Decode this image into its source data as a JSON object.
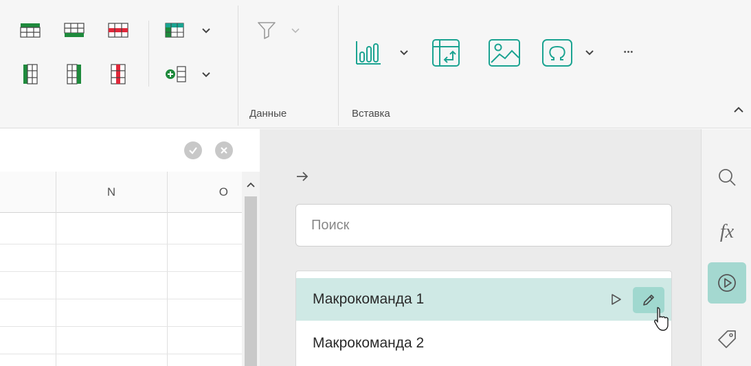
{
  "ribbon": {
    "groups": {
      "data": {
        "label": "Данные"
      },
      "insert": {
        "label": "Вставка"
      }
    },
    "buttons": {
      "insert_rows_above": "insert-rows-above-icon",
      "insert_rows_below": "insert-rows-below-icon",
      "delete_rows": "delete-rows-icon",
      "insert_cols_left": "insert-cols-left-icon",
      "insert_cols_right": "insert-cols-right-icon",
      "delete_cols": "delete-cols-icon",
      "format_table": "format-table-icon",
      "add_column": "add-column-icon",
      "filter": "filter-icon",
      "chart": "bar-chart-icon",
      "pivot_table": "pivot-table-icon",
      "image": "image-icon",
      "special_symbol": "omega-icon",
      "more": "ellipsis-icon"
    },
    "more_label": "•••"
  },
  "grid": {
    "columns": [
      "N",
      "O"
    ]
  },
  "macros_panel": {
    "search_placeholder": "Поиск",
    "items": [
      {
        "label": "Макрокоманда 1",
        "selected": true
      },
      {
        "label": "Макрокоманда 2",
        "selected": false
      }
    ]
  },
  "sidebar": {
    "fx_label": "fx",
    "active": "macros"
  },
  "colors": {
    "accent": "#1aa391",
    "selected_row": "#cfe9e5",
    "active_button": "#a4d8d0",
    "table_green": "#1e8a3c",
    "table_red": "#e0283a"
  }
}
